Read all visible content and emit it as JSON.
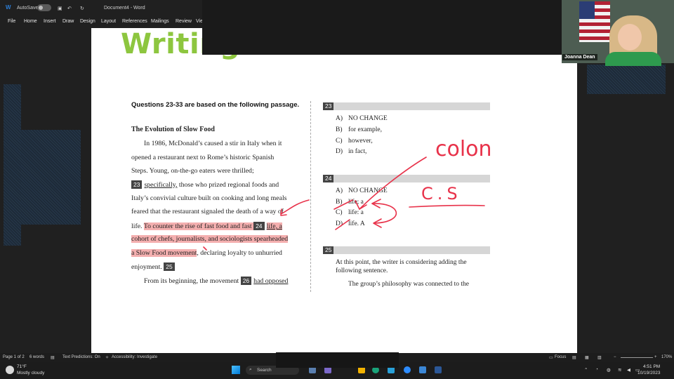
{
  "titlebar": {
    "autosave": "AutoSave",
    "doc_name": "Document4 - Word"
  },
  "ribbon": {
    "tabs": [
      "File",
      "Home",
      "Insert",
      "Draw",
      "Design",
      "Layout",
      "References",
      "Mailings",
      "Review",
      "Vie"
    ]
  },
  "document": {
    "banner_title": "Writing",
    "questions_header": "Questions 23-33 are based on the following passage.",
    "passage_title": "The Evolution of Slow Food",
    "passage_lines": {
      "l1": "In 1986, McDonald’s caused a stir in Italy when it",
      "l2": "opened a restaurant next to Rome’s historic Spanish",
      "l3": "Steps. Young, on-the-go eaters were thrilled;",
      "l4_num": "23",
      "l4_u": "specifically,",
      "l4_rest": " those who prized regional foods and",
      "l5": "Italy’s convivial culture built on cooking and long meals",
      "l6": "feared that the restaurant signaled the death of a way of",
      "l7_a": "life. ",
      "l7_hl": "To counter the rise of fast food and fast ",
      "l7_num": "24",
      "l7_u": "life, a",
      "l8": "cohort of chefs, journalists, and sociologists spearheaded",
      "l9_hl": "a Slow Food movement",
      "l9_rest": ", declaring loyalty to unhurried",
      "l10": "enjoyment.",
      "l10_num": "25",
      "l11": "From its beginning, the movement",
      "l11_num": "26",
      "l11_u": "had opposed"
    },
    "q23": {
      "num": "23",
      "options": [
        {
          "letter": "A)",
          "text": "NO CHANGE"
        },
        {
          "letter": "B)",
          "text": "for example,"
        },
        {
          "letter": "C)",
          "text": "however,"
        },
        {
          "letter": "D)",
          "text": "in fact,"
        }
      ]
    },
    "q24": {
      "num": "24",
      "options": [
        {
          "letter": "A)",
          "text": "NO CHANGE"
        },
        {
          "letter": "B)",
          "text": "life; a"
        },
        {
          "letter": "C)",
          "text": "life: a"
        },
        {
          "letter": "D)",
          "text": "life. A"
        }
      ]
    },
    "q25": {
      "num": "25",
      "stem1": "At this point, the writer is considering adding the",
      "stem2": "following sentence.",
      "quote": "The group’s philosophy was connected to the"
    },
    "annotations": {
      "word": "colon",
      "cs": "C.S"
    }
  },
  "camera": {
    "name": "Joanna Dean"
  },
  "statusbar": {
    "page": "Page 1 of 2",
    "words": "6 words",
    "predictions": "Text Predictions: On",
    "accessibility": "Accessibility: Investigate",
    "focus": "Focus",
    "zoom": "170%"
  },
  "taskbar": {
    "weather_temp": "71°F",
    "weather_desc": "Mostly cloudy",
    "search": "Search",
    "time": "4:51 PM",
    "date": "10/19/2023"
  }
}
